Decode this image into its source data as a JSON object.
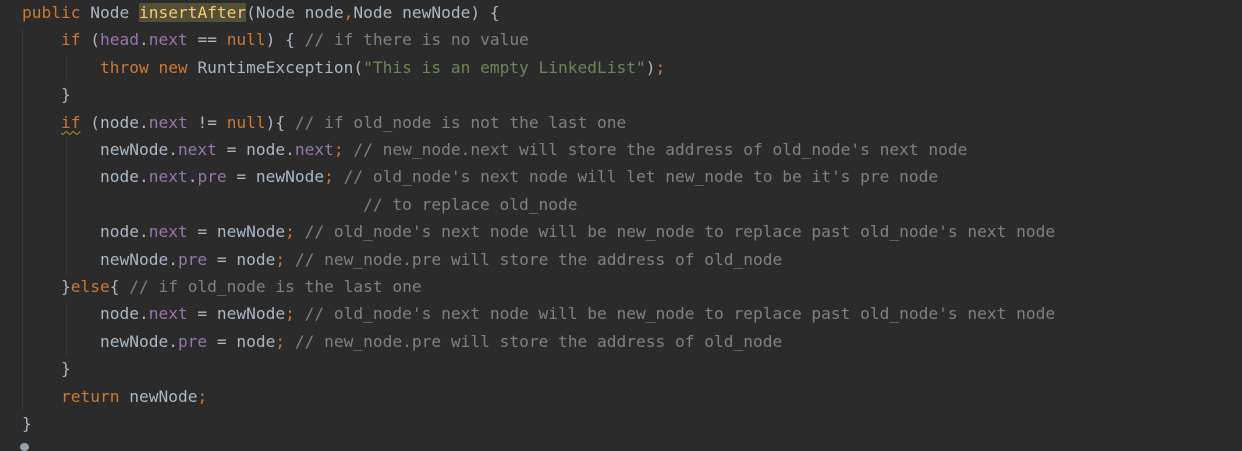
{
  "editor": {
    "lines": [
      [
        {
          "t": "public ",
          "c": "kw"
        },
        {
          "t": "Node ",
          "c": "pl"
        },
        {
          "t": "insertAfter",
          "c": "fn hl"
        },
        {
          "t": "(Node node",
          "c": "pl"
        },
        {
          "t": ",",
          "c": "kw"
        },
        {
          "t": "Node newNode) {",
          "c": "pl"
        }
      ],
      [
        {
          "t": "    "
        },
        {
          "t": "if ",
          "c": "kw"
        },
        {
          "t": "(",
          "c": "pl"
        },
        {
          "t": "head",
          "c": "field"
        },
        {
          "t": ".",
          "c": "pl"
        },
        {
          "t": "next",
          "c": "field"
        },
        {
          "t": " == ",
          "c": "pl"
        },
        {
          "t": "null",
          "c": "kw"
        },
        {
          "t": ") { ",
          "c": "pl"
        },
        {
          "t": "// if there is no value",
          "c": "cmt"
        }
      ],
      [
        {
          "t": "        "
        },
        {
          "t": "throw new ",
          "c": "kw"
        },
        {
          "t": "RuntimeException(",
          "c": "pl"
        },
        {
          "t": "\"This is an empty LinkedList\"",
          "c": "str"
        },
        {
          "t": ")",
          "c": "pl"
        },
        {
          "t": ";",
          "c": "kw"
        }
      ],
      [
        {
          "t": "    "
        },
        {
          "t": "}",
          "c": "pl"
        }
      ],
      [
        {
          "t": "    "
        },
        {
          "t": "if",
          "c": "kw warn"
        },
        {
          "t": " (node.",
          "c": "pl"
        },
        {
          "t": "next",
          "c": "field"
        },
        {
          "t": " != ",
          "c": "pl"
        },
        {
          "t": "null",
          "c": "kw"
        },
        {
          "t": "){ ",
          "c": "pl"
        },
        {
          "t": "// if old_node is not the last one",
          "c": "cmt"
        }
      ],
      [
        {
          "t": "        "
        },
        {
          "t": "newNode.",
          "c": "pl"
        },
        {
          "t": "next",
          "c": "field"
        },
        {
          "t": " = node.",
          "c": "pl"
        },
        {
          "t": "next",
          "c": "field"
        },
        {
          "t": "; ",
          "c": "kw"
        },
        {
          "t": "// new_node.next will store the address of old_node's next node",
          "c": "cmt"
        }
      ],
      [
        {
          "t": "        "
        },
        {
          "t": "node.",
          "c": "pl"
        },
        {
          "t": "next",
          "c": "field"
        },
        {
          "t": ".",
          "c": "pl"
        },
        {
          "t": "pre",
          "c": "field"
        },
        {
          "t": " = newNode",
          "c": "pl"
        },
        {
          "t": "; ",
          "c": "kw"
        },
        {
          "t": "// old_node's next node will let new_node to be it's pre node",
          "c": "cmt"
        }
      ],
      [
        {
          "t": "                                   "
        },
        {
          "t": "// to replace old_node",
          "c": "cmt"
        }
      ],
      [
        {
          "t": "        "
        },
        {
          "t": "node.",
          "c": "pl"
        },
        {
          "t": "next",
          "c": "field"
        },
        {
          "t": " = newNode",
          "c": "pl"
        },
        {
          "t": "; ",
          "c": "kw"
        },
        {
          "t": "// old_node's next node will be new_node to replace past old_node's next node",
          "c": "cmt"
        }
      ],
      [
        {
          "t": "        "
        },
        {
          "t": "newNode.",
          "c": "pl"
        },
        {
          "t": "pre",
          "c": "field"
        },
        {
          "t": " = node",
          "c": "pl"
        },
        {
          "t": "; ",
          "c": "kw"
        },
        {
          "t": "// new_node.pre will store the address of old_node",
          "c": "cmt"
        }
      ],
      [
        {
          "t": "    "
        },
        {
          "t": "}",
          "c": "pl"
        },
        {
          "t": "else",
          "c": "kw"
        },
        {
          "t": "{ ",
          "c": "pl"
        },
        {
          "t": "// if old_node is the last one",
          "c": "cmt"
        }
      ],
      [
        {
          "t": "        "
        },
        {
          "t": "node.",
          "c": "pl"
        },
        {
          "t": "next",
          "c": "field"
        },
        {
          "t": " = newNode",
          "c": "pl"
        },
        {
          "t": "; ",
          "c": "kw"
        },
        {
          "t": "// old_node's next node will be new_node to replace past old_node's next node",
          "c": "cmt"
        }
      ],
      [
        {
          "t": "        "
        },
        {
          "t": "newNode.",
          "c": "pl"
        },
        {
          "t": "pre",
          "c": "field"
        },
        {
          "t": " = node",
          "c": "pl"
        },
        {
          "t": "; ",
          "c": "kw"
        },
        {
          "t": "// new_node.pre will store the address of old_node",
          "c": "cmt"
        }
      ],
      [
        {
          "t": "    "
        },
        {
          "t": "}",
          "c": "pl"
        }
      ],
      [
        {
          "t": "    "
        },
        {
          "t": "return ",
          "c": "kw"
        },
        {
          "t": "newNode",
          "c": "pl"
        },
        {
          "t": ";",
          "c": "kw"
        }
      ],
      [
        {
          "t": "}",
          "c": "pl"
        }
      ]
    ]
  },
  "colors": {
    "background": "#2b2b2b",
    "keyword": "#cc7832",
    "method_declaration": "#ffc66d",
    "field": "#9876aa",
    "string": "#6a8759",
    "comment": "#808080",
    "plain": "#a9b7c6",
    "highlight": "#52503a",
    "warning_underline": "#be9117"
  }
}
